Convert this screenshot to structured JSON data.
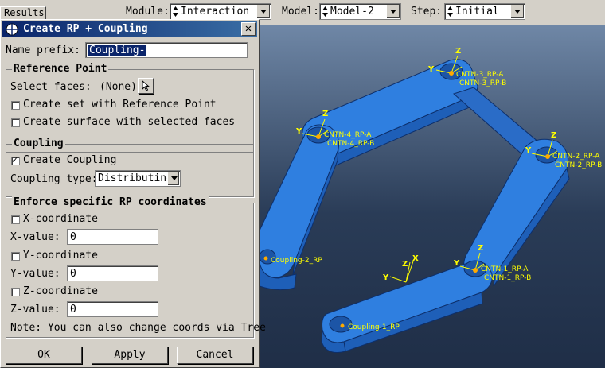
{
  "context_bar": {
    "module_label": "Module:",
    "module_value": "Interaction",
    "model_label": "Model:",
    "model_value": "Model-2",
    "step_label": "Step:",
    "step_value": "Initial"
  },
  "results_tab": "Results",
  "dialog": {
    "title": "Create RP + Coupling",
    "name_prefix_label": "Name prefix:",
    "name_prefix_value": "Coupling-",
    "reference_point": {
      "title": "Reference Point",
      "select_faces_label": "Select faces:",
      "select_faces_value": "(None)",
      "create_set_label": "Create set with Reference Point",
      "create_set_checked": false,
      "create_surface_label": "Create surface with selected faces",
      "create_surface_checked": false
    },
    "coupling": {
      "title": "Coupling",
      "create_coupling_label": "Create Coupling",
      "create_coupling_checked": true,
      "coupling_type_label": "Coupling type:",
      "coupling_type_value": "Distributing"
    },
    "enforce": {
      "title": "Enforce specific RP coordinates",
      "x_coord_label": "X-coordinate",
      "x_value_label": "X-value:",
      "x_value": "0",
      "y_coord_label": "Y-coordinate",
      "y_value_label": "Y-value:",
      "y_value": "0",
      "z_coord_label": "Z-coordinate",
      "z_value_label": "Z-value:",
      "z_value": "0",
      "note": "Note: You can also change coords via Tree"
    },
    "buttons": {
      "ok": "OK",
      "apply": "Apply",
      "cancel": "Cancel"
    }
  },
  "viewport": {
    "labels": {
      "cntn3a": "CNTN-3_RP-A",
      "cntn3b": "CNTN-3_RP-B",
      "cntn4a": "CNTN-4_RP-A",
      "cntn4b": "CNTN-4_RP-B",
      "cntn2a": "CNTN-2_RP-A",
      "cntn2b": "CNTN-2_RP-B",
      "cntn1a": "CNTN-1_RP-A",
      "cntn1b": "CNTN-1_RP-B",
      "coupling2": "Coupling-2_RP",
      "coupling1": "Coupling-1_RP"
    },
    "axes": {
      "x": "X",
      "y": "Y",
      "z": "Z"
    },
    "part_color": "#2f7fe0",
    "label_color": "#ffff00"
  }
}
